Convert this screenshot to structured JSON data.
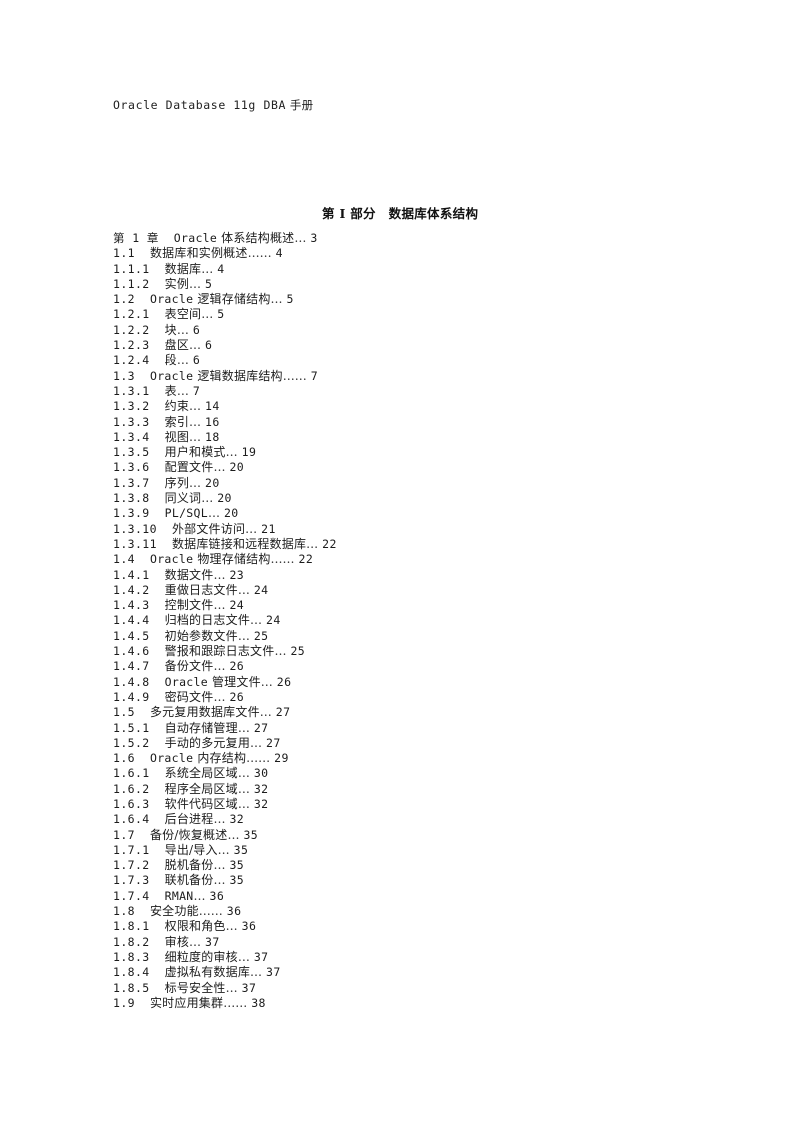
{
  "header": {
    "running_title_latin": "Oracle Database 11g DBA",
    "running_title_cjk": " 手册"
  },
  "part": {
    "title": "第 I 部分　数据库体系结构"
  },
  "toc": {
    "leader_char": "…",
    "entries": [
      {
        "num": "第 1 章",
        "level": "chapter",
        "title_pre": "Oracle",
        "title": " 体系结构概述",
        "leader": "…",
        "page": "3"
      },
      {
        "num": "1.1",
        "level": "1",
        "title_pre": "",
        "title": "数据库和实例概述",
        "leader": "……",
        "page": "4"
      },
      {
        "num": "1.1.1",
        "level": "2",
        "title_pre": "",
        "title": "数据库",
        "leader": "…",
        "page": "4"
      },
      {
        "num": "1.1.2",
        "level": "2",
        "title_pre": "",
        "title": "实例",
        "leader": "…",
        "page": "5"
      },
      {
        "num": "1.2",
        "level": "1",
        "title_pre": "Oracle",
        "title": " 逻辑存储结构",
        "leader": "…",
        "page": "5"
      },
      {
        "num": "1.2.1",
        "level": "2",
        "title_pre": "",
        "title": "表空间",
        "leader": "…",
        "page": "5"
      },
      {
        "num": "1.2.2",
        "level": "2",
        "title_pre": "",
        "title": "块",
        "leader": "…",
        "page": "6"
      },
      {
        "num": "1.2.3",
        "level": "2",
        "title_pre": "",
        "title": "盘区",
        "leader": "…",
        "page": "6"
      },
      {
        "num": "1.2.4",
        "level": "2",
        "title_pre": "",
        "title": "段",
        "leader": "…",
        "page": "6"
      },
      {
        "num": "1.3",
        "level": "1",
        "title_pre": "Oracle",
        "title": " 逻辑数据库结构",
        "leader": "……",
        "page": "7"
      },
      {
        "num": "1.3.1",
        "level": "2",
        "title_pre": "",
        "title": "表",
        "leader": "…",
        "page": "7"
      },
      {
        "num": "1.3.2",
        "level": "2",
        "title_pre": "",
        "title": "约束",
        "leader": "…",
        "page": "14"
      },
      {
        "num": "1.3.3",
        "level": "2",
        "title_pre": "",
        "title": "索引",
        "leader": "…",
        "page": "16"
      },
      {
        "num": "1.3.4",
        "level": "2",
        "title_pre": "",
        "title": "视图",
        "leader": "…",
        "page": "18"
      },
      {
        "num": "1.3.5",
        "level": "2",
        "title_pre": "",
        "title": "用户和模式",
        "leader": "…",
        "page": "19"
      },
      {
        "num": "1.3.6",
        "level": "2",
        "title_pre": "",
        "title": "配置文件",
        "leader": "…",
        "page": "20"
      },
      {
        "num": "1.3.7",
        "level": "2",
        "title_pre": "",
        "title": "序列",
        "leader": "…",
        "page": "20"
      },
      {
        "num": "1.3.8",
        "level": "2",
        "title_pre": "",
        "title": "同义词",
        "leader": "…",
        "page": "20"
      },
      {
        "num": "1.3.9",
        "level": "2",
        "title_pre": "PL/SQL",
        "title": "",
        "leader": "…",
        "page": "20"
      },
      {
        "num": "1.3.10",
        "level": "2",
        "title_pre": "",
        "title": "外部文件访问",
        "leader": "…",
        "page": "21"
      },
      {
        "num": "1.3.11",
        "level": "2",
        "title_pre": "",
        "title": "数据库链接和远程数据库",
        "leader": "…",
        "page": "22"
      },
      {
        "num": "1.4",
        "level": "1",
        "title_pre": "Oracle",
        "title": " 物理存储结构",
        "leader": "……",
        "page": "22"
      },
      {
        "num": "1.4.1",
        "level": "2",
        "title_pre": "",
        "title": "数据文件",
        "leader": "…",
        "page": "23"
      },
      {
        "num": "1.4.2",
        "level": "2",
        "title_pre": "",
        "title": "重做日志文件",
        "leader": "…",
        "page": "24"
      },
      {
        "num": "1.4.3",
        "level": "2",
        "title_pre": "",
        "title": "控制文件",
        "leader": "…",
        "page": "24"
      },
      {
        "num": "1.4.4",
        "level": "2",
        "title_pre": "",
        "title": "归档的日志文件",
        "leader": "…",
        "page": "24"
      },
      {
        "num": "1.4.5",
        "level": "2",
        "title_pre": "",
        "title": "初始参数文件",
        "leader": "…",
        "page": "25"
      },
      {
        "num": "1.4.6",
        "level": "2",
        "title_pre": "",
        "title": "警报和跟踪日志文件",
        "leader": "…",
        "page": "25"
      },
      {
        "num": "1.4.7",
        "level": "2",
        "title_pre": "",
        "title": "备份文件",
        "leader": "…",
        "page": "26"
      },
      {
        "num": "1.4.8",
        "level": "2",
        "title_pre": "Oracle",
        "title": " 管理文件",
        "leader": "…",
        "page": "26"
      },
      {
        "num": "1.4.9",
        "level": "2",
        "title_pre": "",
        "title": "密码文件",
        "leader": "…",
        "page": "26"
      },
      {
        "num": "1.5",
        "level": "1",
        "title_pre": "",
        "title": "多元复用数据库文件",
        "leader": "…",
        "page": "27"
      },
      {
        "num": "1.5.1",
        "level": "2",
        "title_pre": "",
        "title": "自动存储管理",
        "leader": "…",
        "page": "27"
      },
      {
        "num": "1.5.2",
        "level": "2",
        "title_pre": "",
        "title": "手动的多元复用",
        "leader": "…",
        "page": "27"
      },
      {
        "num": "1.6",
        "level": "1",
        "title_pre": "Oracle",
        "title": " 内存结构",
        "leader": "……",
        "page": "29"
      },
      {
        "num": "1.6.1",
        "level": "2",
        "title_pre": "",
        "title": "系统全局区域",
        "leader": "…",
        "page": "30"
      },
      {
        "num": "1.6.2",
        "level": "2",
        "title_pre": "",
        "title": "程序全局区域",
        "leader": "…",
        "page": "32"
      },
      {
        "num": "1.6.3",
        "level": "2",
        "title_pre": "",
        "title": "软件代码区域",
        "leader": "…",
        "page": "32"
      },
      {
        "num": "1.6.4",
        "level": "2",
        "title_pre": "",
        "title": "后台进程",
        "leader": "…",
        "page": "32"
      },
      {
        "num": "1.7",
        "level": "1",
        "title_pre": "",
        "title": "备份/恢复概述",
        "leader": "…",
        "page": "35"
      },
      {
        "num": "1.7.1",
        "level": "2",
        "title_pre": "",
        "title": "导出/导入",
        "leader": "…",
        "page": "35"
      },
      {
        "num": "1.7.2",
        "level": "2",
        "title_pre": "",
        "title": "脱机备份",
        "leader": "…",
        "page": "35"
      },
      {
        "num": "1.7.3",
        "level": "2",
        "title_pre": "",
        "title": "联机备份",
        "leader": "…",
        "page": "35"
      },
      {
        "num": "1.7.4",
        "level": "2",
        "title_pre": "RMAN",
        "title": "",
        "leader": "…",
        "page": "36"
      },
      {
        "num": "1.8",
        "level": "1",
        "title_pre": "",
        "title": "安全功能",
        "leader": "……",
        "page": "36"
      },
      {
        "num": "1.8.1",
        "level": "2",
        "title_pre": "",
        "title": "权限和角色",
        "leader": "…",
        "page": "36"
      },
      {
        "num": "1.8.2",
        "level": "2",
        "title_pre": "",
        "title": "审核",
        "leader": "…",
        "page": "37"
      },
      {
        "num": "1.8.3",
        "level": "2",
        "title_pre": "",
        "title": "细粒度的审核",
        "leader": "…",
        "page": "37"
      },
      {
        "num": "1.8.4",
        "level": "2",
        "title_pre": "",
        "title": "虚拟私有数据库",
        "leader": "…",
        "page": "37"
      },
      {
        "num": "1.8.5",
        "level": "2",
        "title_pre": "",
        "title": "标号安全性",
        "leader": "…",
        "page": "37"
      },
      {
        "num": "1.9",
        "level": "1",
        "title_pre": "",
        "title": "实时应用集群",
        "leader": "……",
        "page": "38"
      }
    ]
  }
}
